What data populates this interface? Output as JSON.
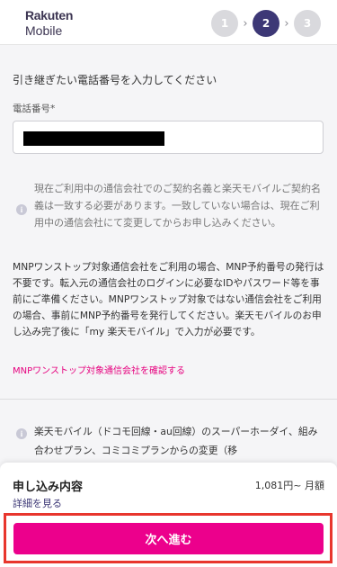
{
  "header": {
    "logo_line1": "Rakuten",
    "logo_line2": "Mobile",
    "steps": [
      "1",
      "2",
      "3"
    ],
    "active_step": 2,
    "chevron": "›"
  },
  "main": {
    "heading": "引き継ぎたい電話番号を入力してください",
    "phone_label": "電話番号*",
    "phone_value": "(redacted)",
    "notice": "現在ご利用中の通信会社でのご契約名義と楽天モバイルご契約名義は一致する必要があります。一致していない場合は、現在ご利用中の通信会社にて変更してからお申し込みください。",
    "mnp_info": "MNPワンストップ対象通信会社をご利用の場合、MNP予約番号の発行は不要です。転入元の通信会社のログインに必要なIDやパスワード等を事前にご準備ください。MNPワンストップ対象ではない通信会社をご利用の場合、事前にMNP予約番号を発行してください。楽天モバイルのお申し込み完了後に「my 楽天モバイル」で入力が必要です。",
    "mnp_link": "MNPワンストップ対象通信会社を確認する",
    "option_note": "楽天モバイル（ドコモ回線・au回線）のスーパーホーダイ、組み合わせプラン、コミコミプランからの変更（移"
  },
  "summary": {
    "title": "申し込み内容",
    "price": "1,081円~ 月額",
    "details_link": "詳細を見る",
    "next_button": "次へ進む"
  },
  "colors": {
    "brand": "#3d3876",
    "accent": "#ec008c",
    "highlight": "#e8362d"
  },
  "icons": {
    "info": "info-icon"
  }
}
